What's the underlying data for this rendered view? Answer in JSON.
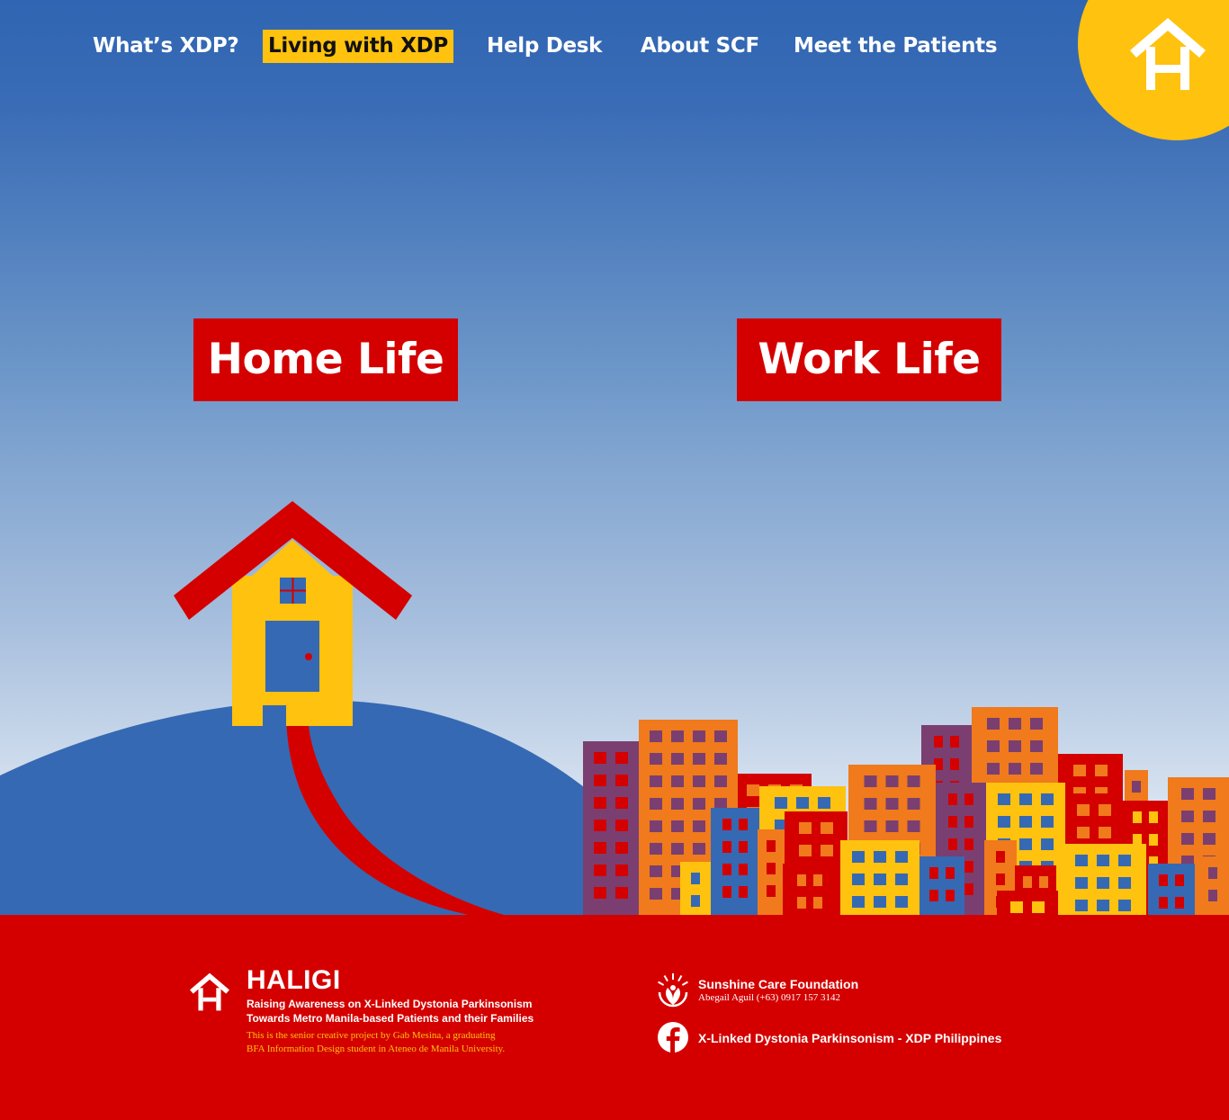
{
  "nav": {
    "items": [
      {
        "label": "What’s XDP?"
      },
      {
        "label": "Living with XDP"
      },
      {
        "label": "Help Desk"
      },
      {
        "label": "About SCF"
      },
      {
        "label": "Meet the Patients"
      }
    ],
    "active_index": 1
  },
  "sections": {
    "home_label": "Home Life",
    "work_label": "Work Life"
  },
  "footer": {
    "brand_title": "HALIGI",
    "brand_subtitle_line1": "Raising Awareness on X-Linked Dystonia Parkinsonism",
    "brand_subtitle_line2": "Towards Metro Manila-based Patients and their Families",
    "credit_line1": "This is the senior creative project by Gab Mesina, a graduating",
    "credit_line2": "BFA Information Design student in Ateneo de Manila University.",
    "scf_name": "Sunshine Care Foundation",
    "scf_contact": "Abegail Aguil (+63) 0917 157 3142",
    "facebook_label": "X-Linked Dystonia Parkinsonism - XDP Philippines"
  },
  "icons": {
    "logo": "haligi-house-icon",
    "scf": "sunshine-care-foundation-icon",
    "facebook": "facebook-icon"
  },
  "colors": {
    "sky_top": "#2f65b2",
    "accent_yellow": "#ffc20e",
    "accent_red": "#d40000",
    "hill_blue": "#3669b3",
    "building_orange": "#f07a1c",
    "building_purple": "#7a3f70"
  }
}
